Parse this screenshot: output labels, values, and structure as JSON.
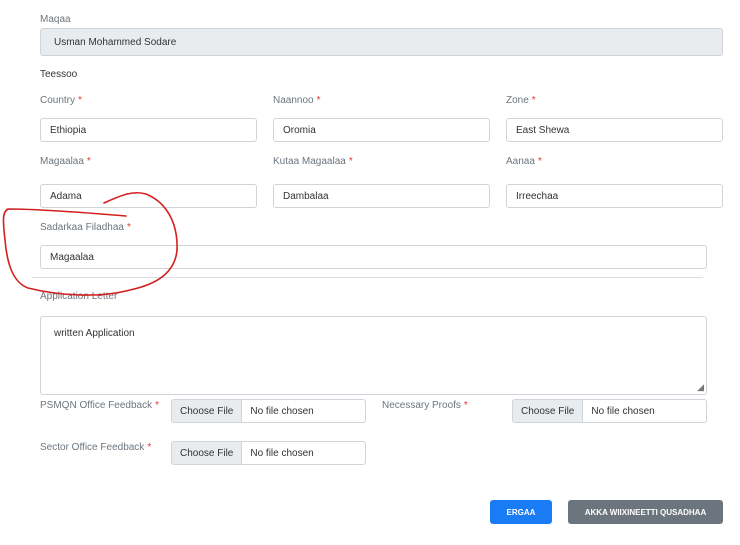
{
  "maqaa": {
    "label": "Maqaa",
    "value": "Usman Mohammed Sodare"
  },
  "teessoo": {
    "heading": "Teessoo"
  },
  "required_marker": "*",
  "fields": {
    "country": {
      "label": "Country",
      "value": "Ethiopia"
    },
    "naannoo": {
      "label": "Naannoo",
      "value": "Oromia"
    },
    "zone": {
      "label": "Zone",
      "value": "East Shewa"
    },
    "magaalaa": {
      "label": "Magaalaa",
      "value": "Adama"
    },
    "kutaa_magaalaa": {
      "label": "Kutaa Magaalaa",
      "value": "Dambalaa"
    },
    "aanaa": {
      "label": "Aanaa",
      "value": "Irreechaa"
    },
    "sadarkaa": {
      "label": "Sadarkaa Filadhaa",
      "value": "Magaalaa"
    }
  },
  "application_letter": {
    "label": "Application Letter",
    "value": "written Application"
  },
  "uploads": {
    "psmqn": {
      "label": "PSMQN Office Feedback",
      "button": "Choose File",
      "status": "No file chosen"
    },
    "necessary": {
      "label": "Necessary Proofs",
      "button": "Choose File",
      "status": "No file chosen"
    },
    "sector": {
      "label": "Sector Office Feedback",
      "button": "Choose File",
      "status": "No file chosen"
    }
  },
  "actions": {
    "submit": "ERGAA",
    "back": "AKKA WIIXINEETTI QUSADHAA"
  },
  "colors": {
    "primary": "#1a7cf5",
    "secondary": "#6c757d",
    "required": "#e3342f",
    "annotation": "#d31f1f"
  }
}
